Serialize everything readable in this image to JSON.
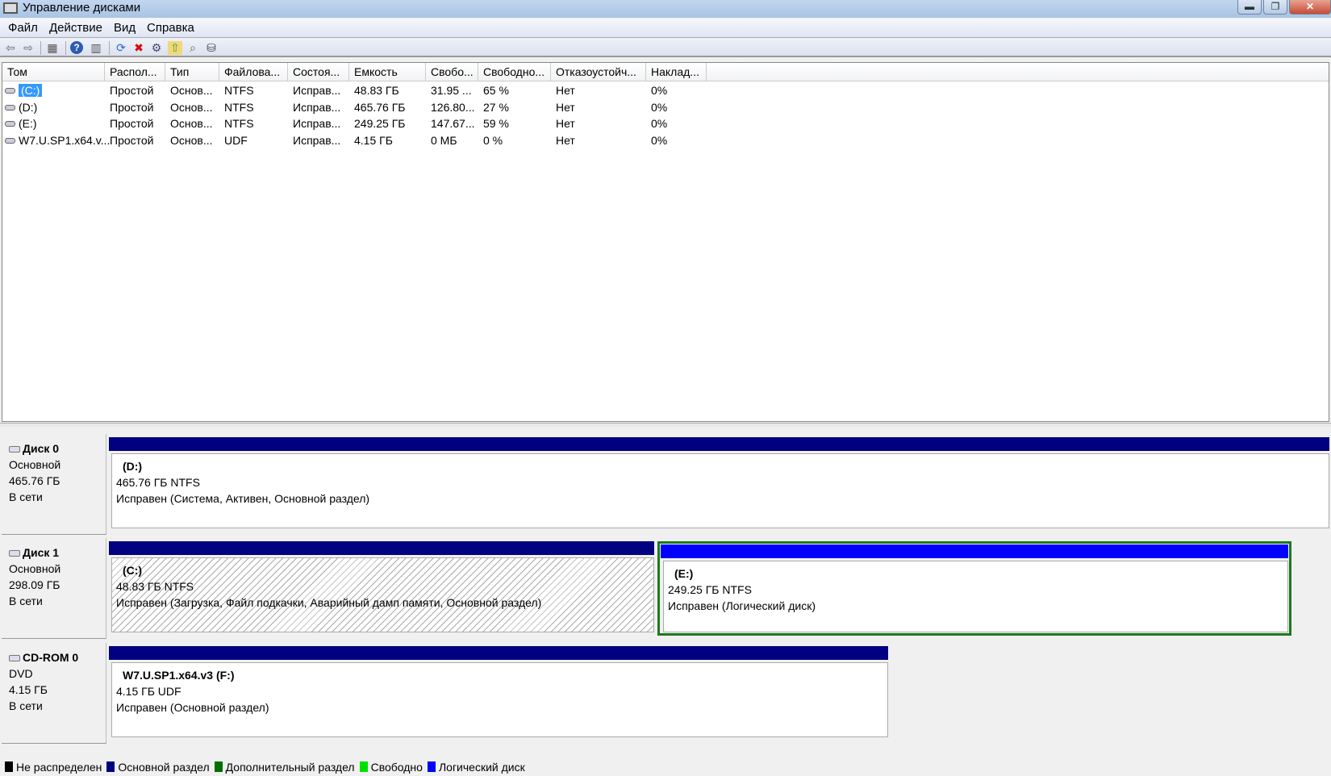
{
  "window": {
    "title": "Управление дисками",
    "controls": {
      "minimize": "▬",
      "restore": "❐",
      "close": "✕"
    }
  },
  "menu": [
    "Файл",
    "Действие",
    "Вид",
    "Справка"
  ],
  "toolbar": {
    "icons": [
      "back-icon",
      "forward-icon",
      "console-tree-icon",
      "help-icon",
      "action-pane-icon",
      "refresh-icon",
      "delete-icon",
      "properties-icon",
      "export-icon",
      "search-icon",
      "rescan-icon"
    ],
    "glyphs": [
      "⇦",
      "⇨",
      "▦",
      "?",
      "▥",
      "⟳",
      "✖",
      "⚙",
      "⇧",
      "⌕",
      "⛁"
    ]
  },
  "table": {
    "columns": [
      "Том",
      "Распол...",
      "Тип",
      "Файлова...",
      "Состоя...",
      "Емкость",
      "Свобо...",
      "Свободно...",
      "Отказоустойч...",
      "Наклад..."
    ],
    "rows": [
      [
        "(C:)",
        "Простой",
        "Основ...",
        "NTFS",
        "Исправ...",
        "48.83 ГБ",
        "31.95 ...",
        "65 %",
        "Нет",
        "0%"
      ],
      [
        "(D:)",
        "Простой",
        "Основ...",
        "NTFS",
        "Исправ...",
        "465.76 ГБ",
        "126.80...",
        "27 %",
        "Нет",
        "0%"
      ],
      [
        "(E:)",
        "Простой",
        "Основ...",
        "NTFS",
        "Исправ...",
        "249.25 ГБ",
        "147.67...",
        "59 %",
        "Нет",
        "0%"
      ],
      [
        "W7.U.SP1.x64.v...",
        "Простой",
        "Основ...",
        "UDF",
        "Исправ...",
        "4.15 ГБ",
        "0 МБ",
        "0 %",
        "Нет",
        "0%"
      ]
    ]
  },
  "disks": [
    {
      "name": "Диск 0",
      "type": "Основной",
      "size": "465.76 ГБ",
      "status": "В сети",
      "partitions": [
        {
          "name": "(D:)",
          "size": "465.76 ГБ NTFS",
          "status": "Исправен (Система, Активен, Основной раздел)"
        }
      ]
    },
    {
      "name": "Диск 1",
      "type": "Основной",
      "size": "298.09 ГБ",
      "status": "В сети",
      "partitions": [
        {
          "name": "(C:)",
          "size": "48.83 ГБ NTFS",
          "status": "Исправен (Загрузка, Файл подкачки, Аварийный дамп памяти, Основной раздел)"
        },
        {
          "name": "(E:)",
          "size": "249.25 ГБ NTFS",
          "status": "Исправен (Логический диск)"
        }
      ]
    },
    {
      "name": "CD-ROM 0",
      "type": "DVD",
      "size": "4.15 ГБ",
      "status": "В сети",
      "partitions": [
        {
          "name": "W7.U.SP1.x64.v3  (F:)",
          "size": "4.15 ГБ UDF",
          "status": "Исправен (Основной раздел)"
        }
      ]
    }
  ],
  "legend": [
    {
      "label": "Не распределен",
      "color": "#000000"
    },
    {
      "label": "Основной раздел",
      "color": "#000080"
    },
    {
      "label": "Дополнительный раздел",
      "color": "#007000"
    },
    {
      "label": "Свободно",
      "color": "#00e000"
    },
    {
      "label": "Логический диск",
      "color": "#0000ff"
    }
  ]
}
